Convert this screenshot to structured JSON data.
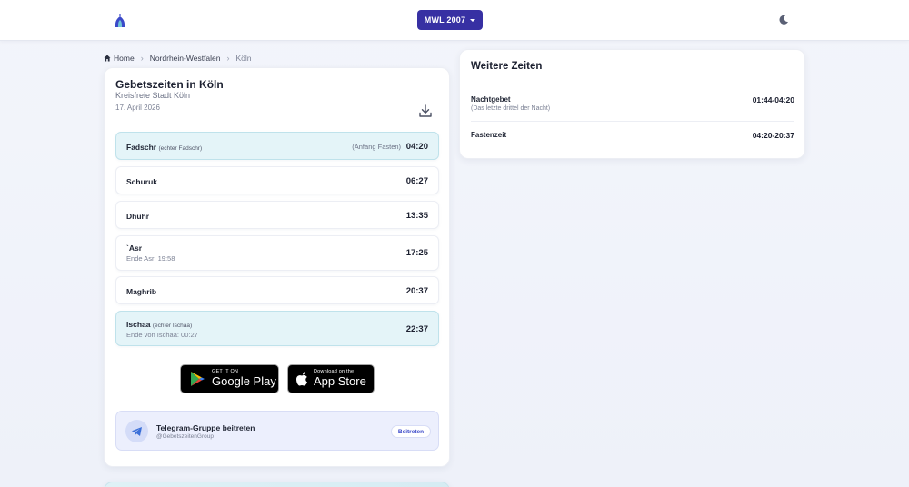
{
  "header": {
    "method_label": "MWL 2007",
    "accent": "#3730a3"
  },
  "breadcrumb": {
    "home": "Home",
    "state": "Nordrhein-Westfalen",
    "city": "Köln"
  },
  "main": {
    "title": "Gebetszeiten in Köln",
    "subtitle": "Kreisfreie Stadt Köln",
    "date": "17. April 2026",
    "prayers": [
      {
        "name": "Fadschr",
        "note": "(echter Fadschr)",
        "prefix": "(Anfang Fasten)",
        "time": "04:20",
        "extra": ""
      },
      {
        "name": "Schuruk",
        "note": "",
        "prefix": "",
        "time": "06:27",
        "extra": ""
      },
      {
        "name": "Dhuhr",
        "note": "",
        "prefix": "",
        "time": "13:35",
        "extra": ""
      },
      {
        "name": "`Asr",
        "note": "",
        "prefix": "",
        "time": "17:25",
        "extra": "Ende Asr: 19:58"
      },
      {
        "name": "Maghrib",
        "note": "",
        "prefix": "",
        "time": "20:37",
        "extra": ""
      },
      {
        "name": "Ischaa",
        "note": "(echter Ischaa)",
        "prefix": "",
        "time": "22:37",
        "extra": "Ende von Ischaa: 00:27"
      }
    ],
    "stores": {
      "google_small": "GET IT ON",
      "google_big": "Google Play",
      "apple_small": "Download on the",
      "apple_big": "App Store"
    },
    "telegram": {
      "title": "Telegram-Gruppe beitreten",
      "handle": "@GebetszeitenGroup",
      "join_label": "Beitreten"
    }
  },
  "side": {
    "title": "Weitere Zeiten",
    "rows": [
      {
        "name": "Nachtgebet",
        "desc": "(Das letzte drittel der Nacht)",
        "value": "01:44-04:20"
      },
      {
        "name": "Fastenzeit",
        "desc": "",
        "value": "04:20-20:37"
      }
    ]
  },
  "icons": {
    "logo": "mosque-logo-icon",
    "theme": "moon-icon",
    "download": "download-icon",
    "telegram": "telegram-icon"
  }
}
